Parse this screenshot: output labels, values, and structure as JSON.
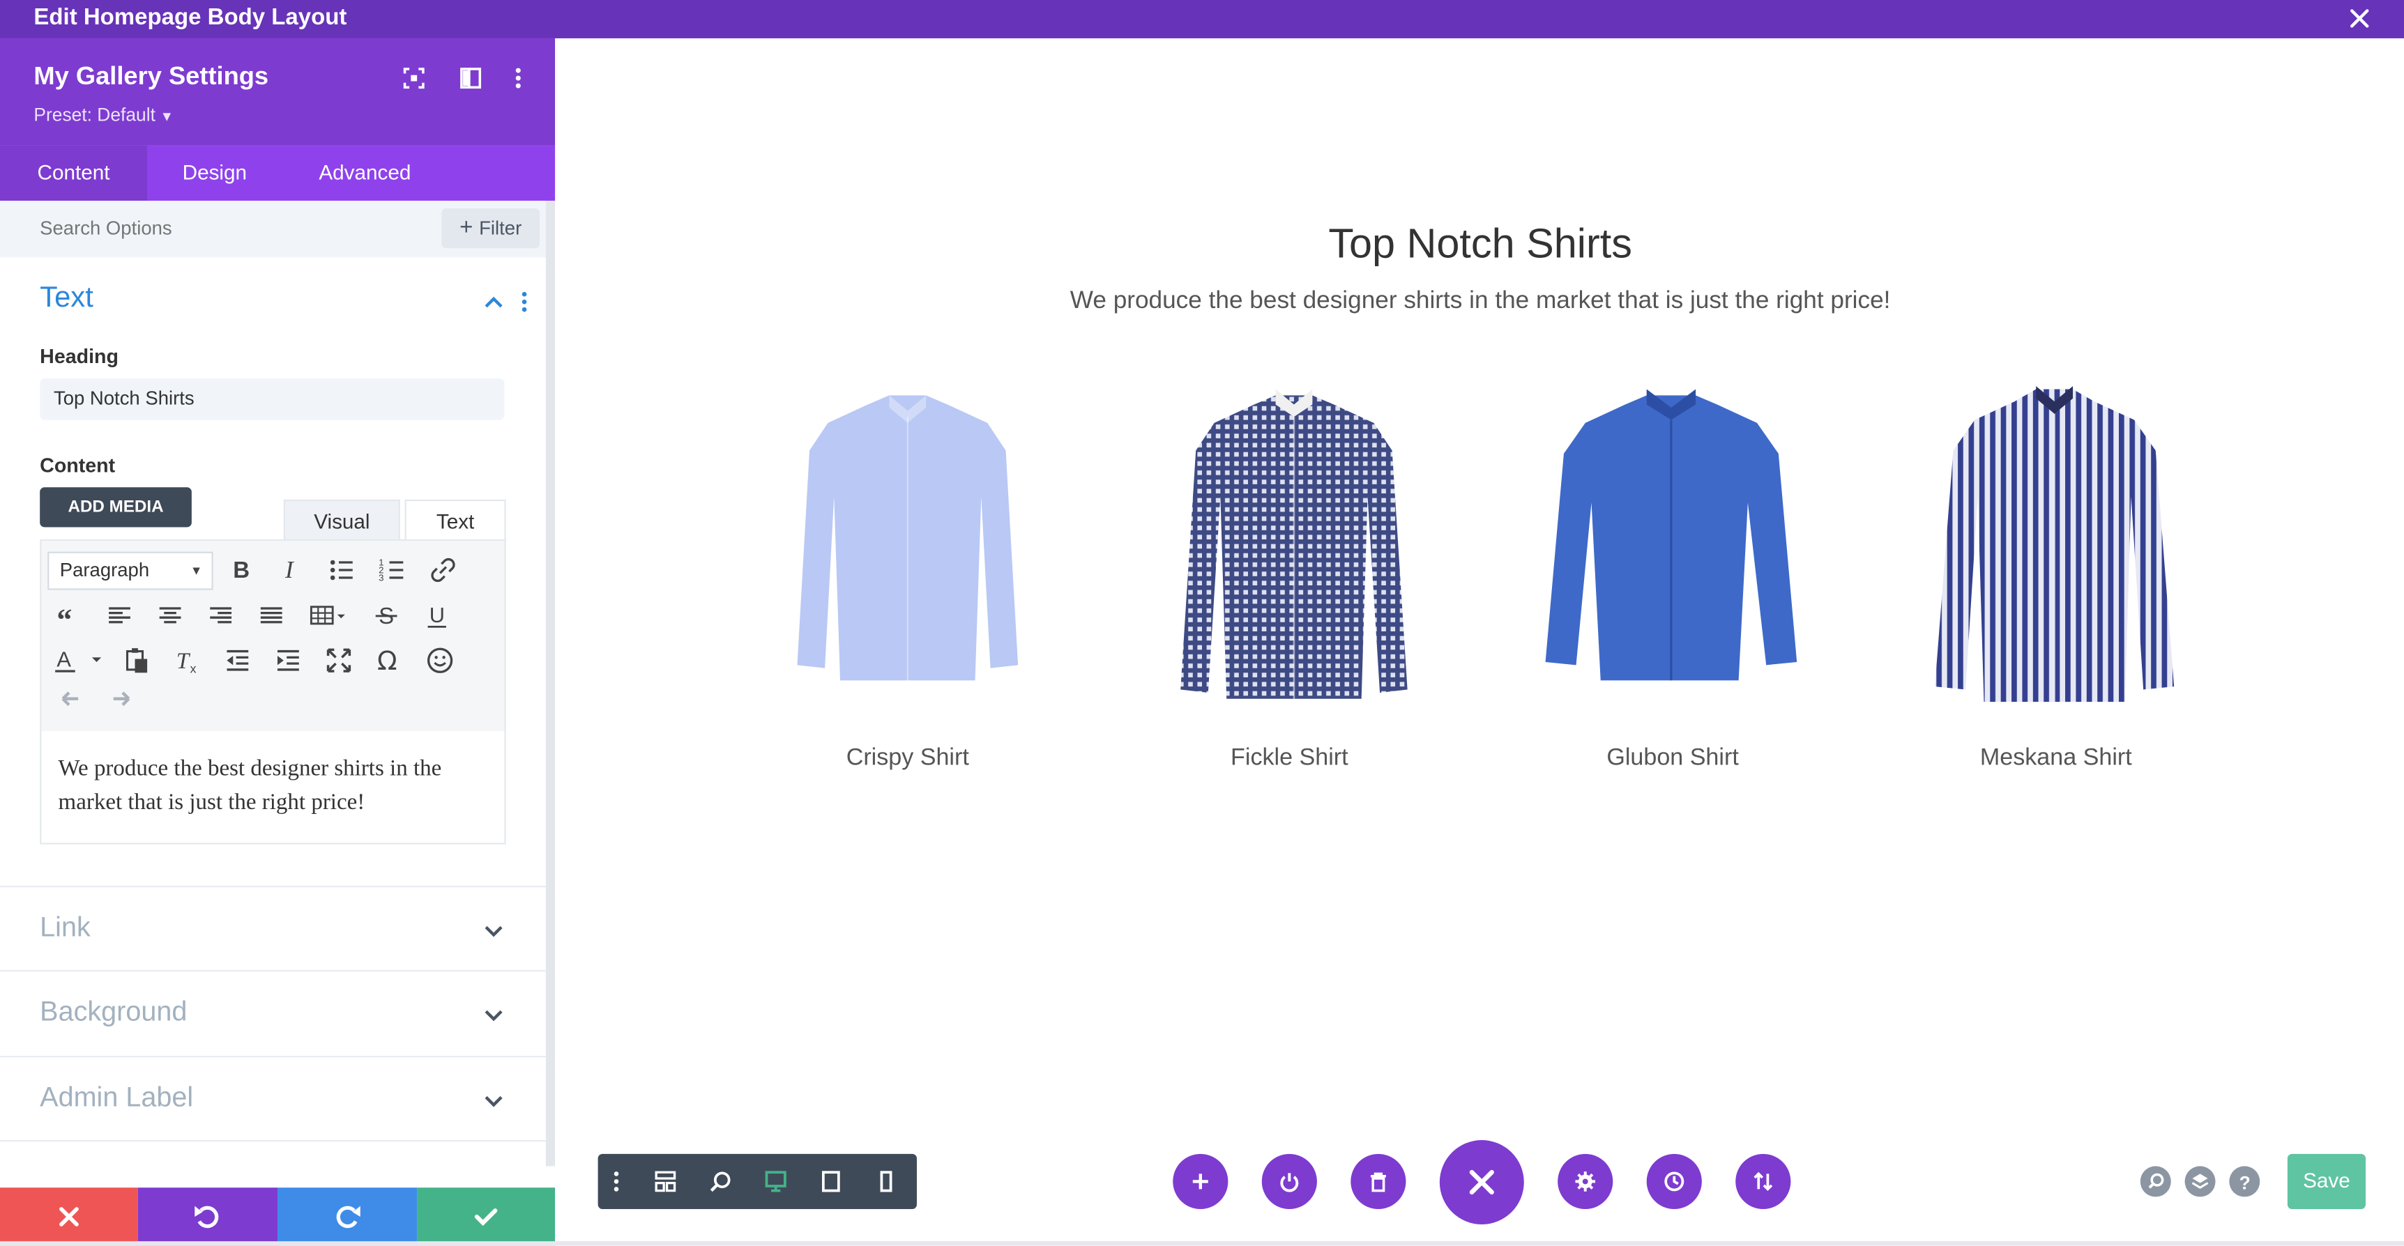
{
  "window": {
    "title": "Edit Homepage Body Layout"
  },
  "sidebar": {
    "title": "My Gallery Settings",
    "preset": "Preset: Default",
    "tabs": [
      {
        "label": "Content"
      },
      {
        "label": "Design"
      },
      {
        "label": "Advanced"
      }
    ],
    "search": {
      "placeholder": "Search Options",
      "filter_label": "Filter"
    },
    "text_section": {
      "title": "Text",
      "heading_label": "Heading",
      "heading_value": "Top Notch Shirts",
      "content_label": "Content",
      "add_media_label": "ADD MEDIA",
      "editor_tabs": [
        "Visual",
        "Text"
      ],
      "format_select": "Paragraph",
      "body": "We produce the best designer shirts in the market that is just the right price!"
    },
    "sections": [
      {
        "title": "Link"
      },
      {
        "title": "Background"
      },
      {
        "title": "Admin Label"
      }
    ]
  },
  "page": {
    "heading": "Top Notch Shirts",
    "subheading": "We produce the best designer shirts in the market that is just the right price!",
    "items": [
      {
        "caption": "Crispy Shirt",
        "color": "#b9c8f4",
        "pattern": "plain"
      },
      {
        "caption": "Fickle Shirt",
        "color": "#5f6596",
        "pattern": "check"
      },
      {
        "caption": "Glubon Shirt",
        "color": "#3e69c9",
        "pattern": "plain"
      },
      {
        "caption": "Meskana Shirt",
        "color": "#454f9e",
        "pattern": "stripe"
      }
    ]
  },
  "bottom_bar": {
    "save_label": "Save"
  },
  "colors": {
    "purple": "#7e3bd0",
    "topbar": "#6733b9",
    "tabs": "#8f42ec",
    "red": "#ef5555",
    "blue": "#3e8ce8",
    "green": "#44b389",
    "save": "#5fc4a1"
  },
  "icons": [
    "close-icon",
    "focus-icon",
    "split-view-icon",
    "more-vertical-icon",
    "chevron-up-icon",
    "chevron-down-icon",
    "plus-icon",
    "bold-icon",
    "italic-icon",
    "bullet-list-icon",
    "numbered-list-icon",
    "link-icon",
    "quote-icon",
    "align-left-icon",
    "align-center-icon",
    "align-right-icon",
    "justify-icon",
    "table-icon",
    "strikethrough-icon",
    "underline-icon",
    "text-color-icon",
    "paste-icon",
    "clear-format-icon",
    "outdent-icon",
    "indent-icon",
    "fullscreen-icon",
    "omega-icon",
    "emoji-icon",
    "undo-icon",
    "redo-icon",
    "wireframe-icon",
    "zoom-icon",
    "desktop-icon",
    "tablet-icon",
    "phone-icon",
    "power-icon",
    "trash-icon",
    "gear-icon",
    "history-icon",
    "sort-icon",
    "search-icon",
    "layers-icon",
    "help-icon",
    "check-icon"
  ]
}
